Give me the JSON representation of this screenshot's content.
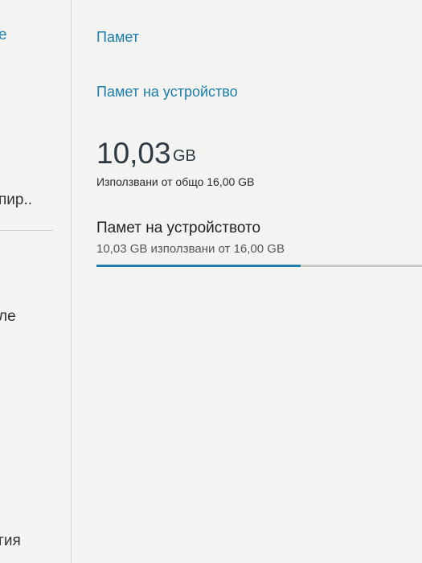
{
  "left_pane": {
    "items": [
      "е",
      "пир..",
      "ле",
      "гия"
    ]
  },
  "detail": {
    "page_title": "Памет",
    "section_header": "Памет на устройство",
    "used_value": "10,03",
    "used_unit": "GB",
    "used_summary": "Използвани от общо 16,00 GB",
    "storage_item": {
      "title": "Памет на устройството",
      "summary": "10,03 GB използвани от 16,00 GB",
      "used_fraction": 0.627
    }
  },
  "colors": {
    "accent": "#1c7ea8",
    "background": "#f3f3f1"
  }
}
